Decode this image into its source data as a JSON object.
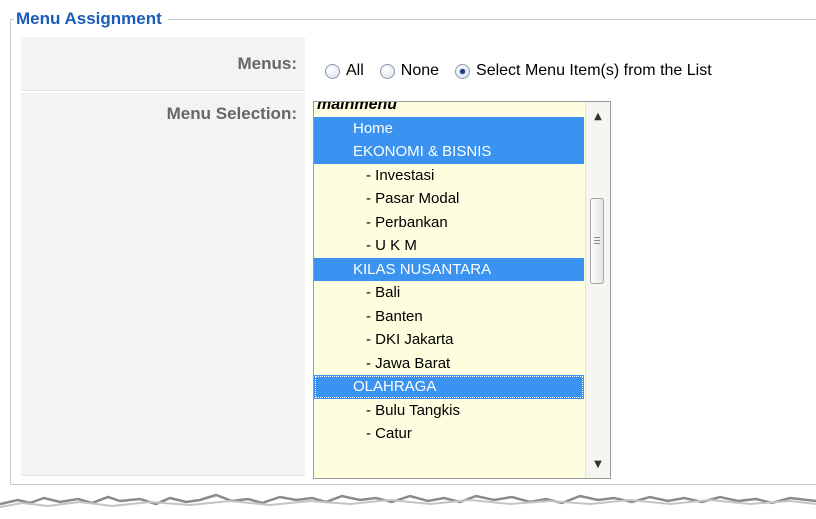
{
  "section": {
    "legend": "Menu Assignment"
  },
  "menus": {
    "label": "Menus:",
    "options": [
      {
        "label": "All",
        "checked": false
      },
      {
        "label": "None",
        "checked": false
      },
      {
        "label": "Select Menu Item(s) from the List",
        "checked": true
      }
    ]
  },
  "selection": {
    "label": "Menu Selection:",
    "items": [
      {
        "text": "mainmenu",
        "type": "group",
        "selected": false
      },
      {
        "text": "Home",
        "type": "item",
        "selected": true
      },
      {
        "text": "EKONOMI & BISNIS",
        "type": "item",
        "selected": true
      },
      {
        "text": "- Investasi",
        "type": "sub",
        "selected": false
      },
      {
        "text": "- Pasar Modal",
        "type": "sub",
        "selected": false
      },
      {
        "text": "- Perbankan",
        "type": "sub",
        "selected": false
      },
      {
        "text": "- U K M",
        "type": "sub",
        "selected": false
      },
      {
        "text": "KILAS NUSANTARA",
        "type": "item",
        "selected": true
      },
      {
        "text": "- Bali",
        "type": "sub",
        "selected": false
      },
      {
        "text": "- Banten",
        "type": "sub",
        "selected": false
      },
      {
        "text": "- DKI Jakarta",
        "type": "sub",
        "selected": false
      },
      {
        "text": "- Jawa Barat",
        "type": "sub",
        "selected": false
      },
      {
        "text": "OLAHRAGA",
        "type": "item",
        "selected": true,
        "focused": true
      },
      {
        "text": "- Bulu Tangkis",
        "type": "sub",
        "selected": false
      },
      {
        "text": "- Catur",
        "type": "sub",
        "selected": false
      }
    ],
    "scrollbar": {
      "up_icon": "triangle-up",
      "down_icon": "triangle-down",
      "grip_icon": "grip-lines"
    }
  },
  "colors": {
    "legend": "#1a5cb8",
    "selected_bg": "#3a93f0",
    "list_bg": "#fdfde0",
    "label_bg": "#f3f3f3"
  }
}
